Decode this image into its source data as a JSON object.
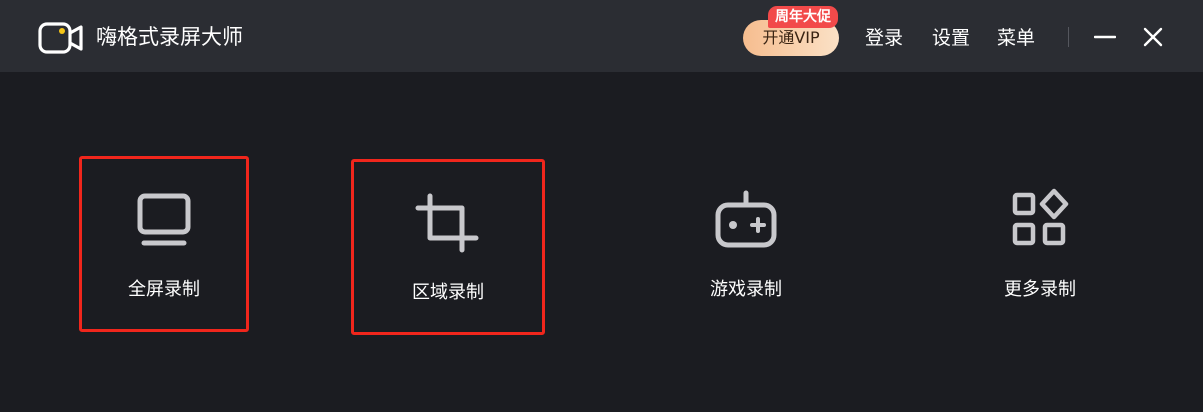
{
  "app": {
    "title": "嗨格式录屏大师"
  },
  "header": {
    "vip_label": "开通VIP",
    "promo_badge": "周年大促",
    "login_label": "登录",
    "settings_label": "设置",
    "menu_label": "菜单"
  },
  "modes": [
    {
      "label": "全屏录制",
      "icon": "monitor-icon",
      "selected": true
    },
    {
      "label": "区域录制",
      "icon": "crop-icon",
      "selected": true
    },
    {
      "label": "游戏录制",
      "icon": "gamepad-icon",
      "selected": false
    },
    {
      "label": "更多录制",
      "icon": "apps-grid-icon",
      "selected": false
    }
  ],
  "colors": {
    "background": "#1b1c21",
    "titlebar": "#2b2d33",
    "icon": "#c8c8cc",
    "highlight_border": "#f0261c",
    "vip_gradient_start": "#f6bd8f",
    "vip_gradient_end": "#fbe1c6",
    "promo_badge": "#f24a4a",
    "logo_dot": "#f5c518"
  }
}
